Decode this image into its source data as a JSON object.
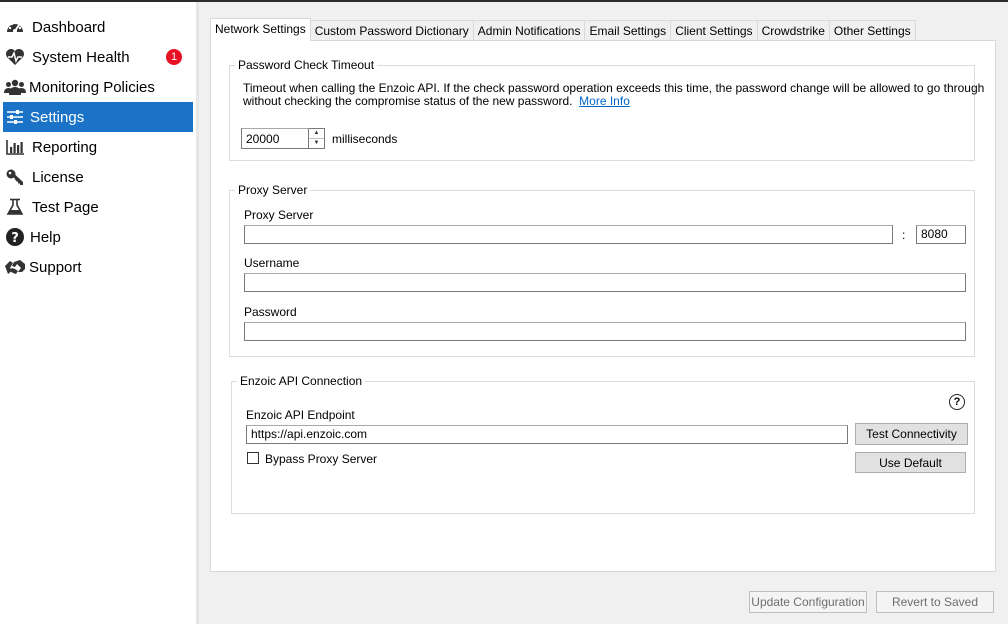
{
  "sidebar": {
    "items": [
      {
        "label": "Dashboard",
        "icon": "dashboard-gauge-icon"
      },
      {
        "label": "System Health",
        "icon": "heart-pulse-icon",
        "badge": "1"
      },
      {
        "label": "Monitoring Policies",
        "icon": "users-group-icon"
      },
      {
        "label": "Settings",
        "icon": "sliders-icon",
        "active": true
      },
      {
        "label": "Reporting",
        "icon": "bar-chart-icon"
      },
      {
        "label": "License",
        "icon": "key-icon"
      },
      {
        "label": "Test Page",
        "icon": "flask-icon"
      },
      {
        "label": "Help",
        "icon": "question-circle-icon"
      },
      {
        "label": "Support",
        "icon": "handshake-icon"
      }
    ],
    "active_color": "#1a73c7",
    "badge_color": "#e81123"
  },
  "tabs": [
    {
      "label": "Network Settings",
      "active": true
    },
    {
      "label": "Custom Password Dictionary"
    },
    {
      "label": "Admin Notifications"
    },
    {
      "label": "Email Settings"
    },
    {
      "label": "Client Settings"
    },
    {
      "label": "Crowdstrike"
    },
    {
      "label": "Other Settings"
    }
  ],
  "password_check": {
    "legend": "Password Check Timeout",
    "description_line1": "Timeout when calling the Enzoic API.  If the check password operation exceeds this time, the password change will be allowed to go through",
    "description_line2": "without checking the compromise status of the new password.",
    "more_info": "More Info",
    "timeout_value": "20000",
    "unit": "milliseconds"
  },
  "proxy": {
    "legend": "Proxy Server",
    "server_label": "Proxy Server",
    "server_value": "",
    "port_separator": ":",
    "port_value": "8080",
    "username_label": "Username",
    "username_value": "",
    "password_label": "Password",
    "password_value": ""
  },
  "api": {
    "legend": "Enzoic API Connection",
    "endpoint_label": "Enzoic API Endpoint",
    "endpoint_value": "https://api.enzoic.com",
    "test_button": "Test Connectivity",
    "default_button": "Use Default",
    "bypass_label": "Bypass Proxy Server",
    "bypass_checked": false,
    "help_glyph": "?"
  },
  "footer": {
    "update_button": "Update Configuration",
    "revert_button": "Revert to Saved"
  }
}
